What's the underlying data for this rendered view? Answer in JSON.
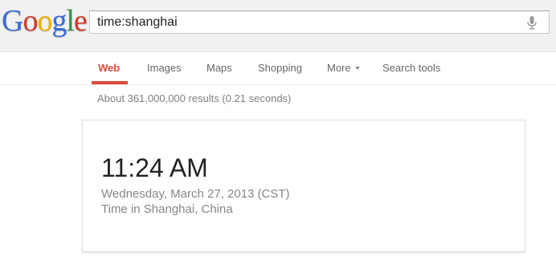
{
  "logo": {
    "letters": [
      "G",
      "o",
      "o",
      "g",
      "l",
      "e"
    ],
    "colors": [
      "#3a6dd9",
      "#d8382c",
      "#f0b400",
      "#3a6dd9",
      "#2c9a3f",
      "#d8382c"
    ]
  },
  "search": {
    "value": "time:shanghai",
    "mic_icon": "microphone-icon"
  },
  "tabs": [
    {
      "label": "Web",
      "active": true
    },
    {
      "label": "Images",
      "active": false
    },
    {
      "label": "Maps",
      "active": false
    },
    {
      "label": "Shopping",
      "active": false
    },
    {
      "label": "More",
      "active": false,
      "has_dropdown": true
    },
    {
      "label": "Search tools",
      "active": false
    }
  ],
  "accent_color": "#dd4b39",
  "result_stats": "About 361,000,000 results (0.21 seconds)",
  "time_card": {
    "time": "11:24 AM",
    "date": "Wednesday, March 27, 2013 (CST)",
    "location": "Time in Shanghai, China"
  }
}
